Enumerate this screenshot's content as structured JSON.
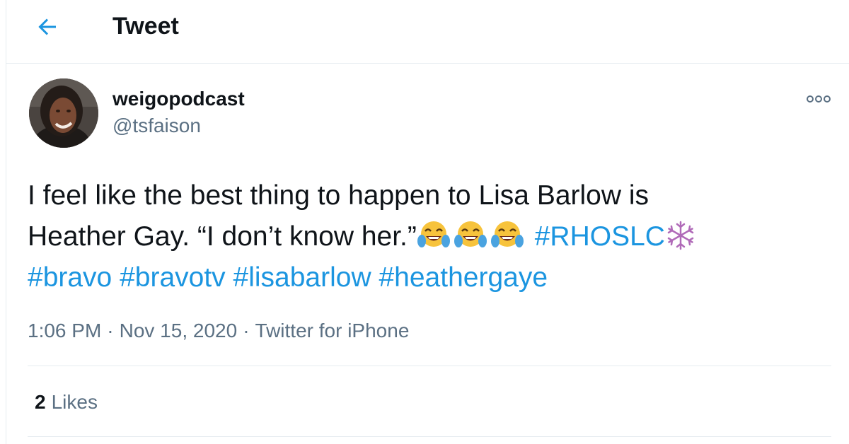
{
  "header": {
    "back_icon": "arrow-left-icon",
    "title": "Tweet"
  },
  "tweet": {
    "author": {
      "display_name": "weigopodcast",
      "handle": "@tsfaison",
      "avatar_icon": "avatar-photo"
    },
    "more_icon": "more-options-icon",
    "text": {
      "line1": "I feel like the best thing to happen to Lisa Barlow is",
      "line2_prefix": "Heather Gay. “I don’t know her.”",
      "emoji": "face-with-tears-of-joy",
      "hashtags": [
        "#RHOSLC",
        "#bravo",
        "#bravotv",
        "#lisabarlow",
        "#heathergaye"
      ],
      "snowflake": "snowflake-emoji"
    },
    "time": "1:06 PM",
    "date": "Nov 15, 2020",
    "source": "Twitter for iPhone",
    "separator": "·",
    "likes": {
      "count": "2",
      "label": "Likes"
    }
  },
  "colors": {
    "accent": "#1b95e0",
    "text": "#0f1419",
    "secondary": "#5b7083",
    "border": "#e6ecf0"
  }
}
